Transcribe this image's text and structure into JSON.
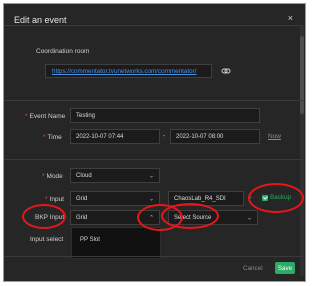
{
  "dialog": {
    "title": "Edit an event",
    "close_symbol": "×"
  },
  "coordination": {
    "label": "Coordination room",
    "url": "https://commentator.tvunetworks.com/commentator/",
    "icon": "copy-link-icon"
  },
  "event": {
    "name_label": "Event Name",
    "name_value": "Testing",
    "time_label": "Time",
    "time_start": "2022-10-07 07:44",
    "time_separator": "-",
    "time_end": "2022-10-07 08:00",
    "now_label": "Now"
  },
  "mode": {
    "label": "Mode",
    "value": "Cloud"
  },
  "input": {
    "label": "Input",
    "value": "Grid",
    "source_value": "ChaosLab_R4_SDI",
    "backup_label": "Backup",
    "backup_checked": true
  },
  "bkp_input": {
    "label": "BKP Input",
    "value": "Grid",
    "source_placeholder": "Select Source",
    "options": [
      "PP Slot"
    ]
  },
  "input_select": {
    "label": "Input select"
  },
  "footer": {
    "cancel_label": "Cancel",
    "save_label": "Save"
  },
  "colors": {
    "accent": "#2bab66",
    "link": "#4a90e2",
    "required": "#e34848",
    "callout": "#e8161b"
  }
}
